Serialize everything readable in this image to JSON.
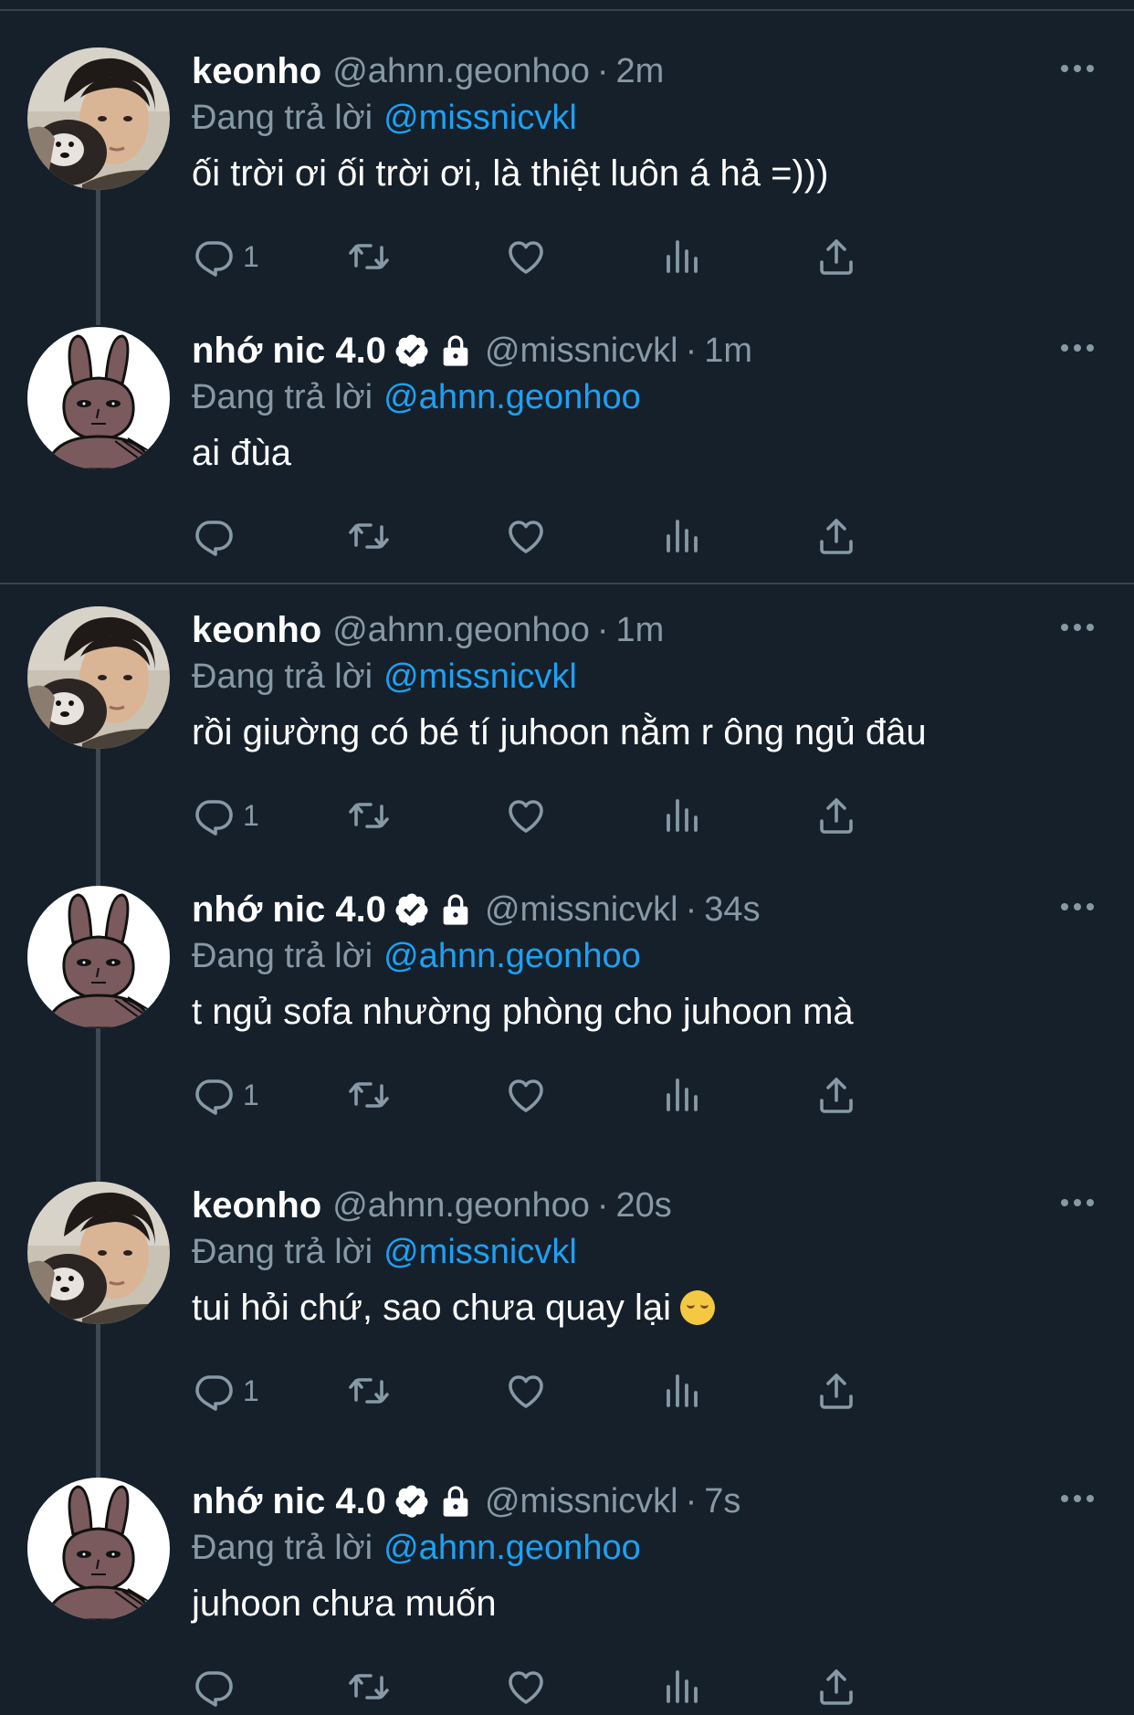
{
  "colors": {
    "background": "#15202b",
    "divider": "#38444d",
    "muted": "#8899a6",
    "link": "#1da1f2",
    "text": "#ffffff"
  },
  "groups": [
    {
      "tweets": [
        {
          "user": "keonho",
          "name": "keonho",
          "handle": "@ahnn.geonhoo",
          "time": "2m",
          "reply_label": "Đang trả lời",
          "reply_to": "@missnicvkl",
          "text": "ối trời ơi ối trời ơi, là thiệt luôn á hả =)))",
          "reply_count": "1",
          "badges": false,
          "emoji": ""
        },
        {
          "user": "nic",
          "name": "nhớ nic 4.0",
          "handle": "@missnicvkl",
          "time": "1m",
          "reply_label": "Đang trả lời",
          "reply_to": "@ahnn.geonhoo",
          "text": "ai đùa",
          "reply_count": "",
          "badges": true,
          "emoji": ""
        }
      ]
    },
    {
      "tweets": [
        {
          "user": "keonho",
          "name": "keonho",
          "handle": "@ahnn.geonhoo",
          "time": "1m",
          "reply_label": "Đang trả lời",
          "reply_to": "@missnicvkl",
          "text": "rồi giường có bé tí juhoon nằm r ông ngủ đâu",
          "reply_count": "1",
          "badges": false,
          "emoji": ""
        },
        {
          "user": "nic",
          "name": "nhớ nic 4.0",
          "handle": "@missnicvkl",
          "time": "34s",
          "reply_label": "Đang trả lời",
          "reply_to": "@ahnn.geonhoo",
          "text": "t ngủ sofa nhường phòng cho juhoon mà",
          "reply_count": "1",
          "badges": true,
          "emoji": ""
        },
        {
          "user": "keonho",
          "name": "keonho",
          "handle": "@ahnn.geonhoo",
          "time": "20s",
          "reply_label": "Đang trả lời",
          "reply_to": "@missnicvkl",
          "text": "tui hỏi chứ, sao chưa quay lại",
          "reply_count": "1",
          "badges": false,
          "emoji": "smiling-face"
        },
        {
          "user": "nic",
          "name": "nhớ nic 4.0",
          "handle": "@missnicvkl",
          "time": "7s",
          "reply_label": "Đang trả lời",
          "reply_to": "@ahnn.geonhoo",
          "text": "juhoon chưa muốn",
          "reply_count": "",
          "badges": true,
          "emoji": ""
        }
      ]
    }
  ],
  "icons": {
    "reply": "reply-icon",
    "retweet": "retweet-icon",
    "like": "like-icon",
    "views": "views-icon",
    "share": "share-icon",
    "more": "more-icon",
    "verified": "verified-icon",
    "lock": "lock-icon"
  }
}
